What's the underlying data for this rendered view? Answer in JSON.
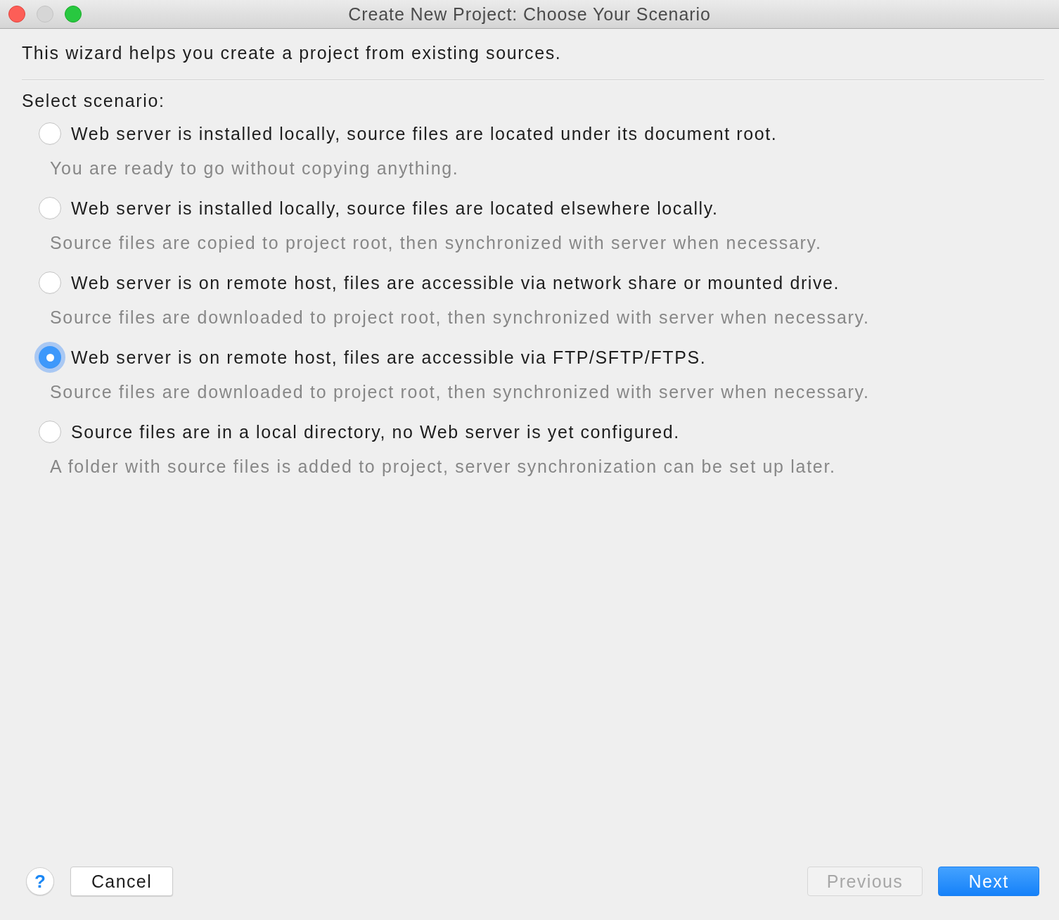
{
  "window": {
    "title": "Create New Project: Choose Your Scenario",
    "controls": [
      {
        "kind": "close",
        "disabled": false
      },
      {
        "kind": "minimize",
        "disabled": true
      },
      {
        "kind": "zoom",
        "disabled": false
      }
    ]
  },
  "intro": "This wizard helps you create a project from existing sources.",
  "scenario_label": "Select scenario:",
  "scenarios": [
    {
      "label": "Web server is installed locally, source files are located under its document root.",
      "description": "You are ready to go without copying anything.",
      "selected": false
    },
    {
      "label": "Web server is installed locally, source files are located elsewhere locally.",
      "description": "Source files are copied to project root, then synchronized with server when necessary.",
      "selected": false
    },
    {
      "label": "Web server is on remote host, files are accessible via network share or mounted drive.",
      "description": "Source files are downloaded to project root, then synchronized with server when necessary.",
      "selected": false
    },
    {
      "label": "Web server is on remote host, files are accessible via FTP/SFTP/FTPS.",
      "description": "Source files are downloaded to project root, then synchronized with server when necessary.",
      "selected": true
    },
    {
      "label": "Source files are in a local directory, no Web server is yet configured.",
      "description": "A folder with source files is added to project, server synchronization can be set up later.",
      "selected": false
    }
  ],
  "buttons": [
    {
      "label": "?",
      "kind": "help",
      "disabled": false
    },
    {
      "label": "Cancel",
      "kind": "default",
      "disabled": false
    },
    {
      "label": "Previous",
      "kind": "default",
      "disabled": true
    },
    {
      "label": "Next",
      "kind": "primary",
      "disabled": false
    }
  ]
}
